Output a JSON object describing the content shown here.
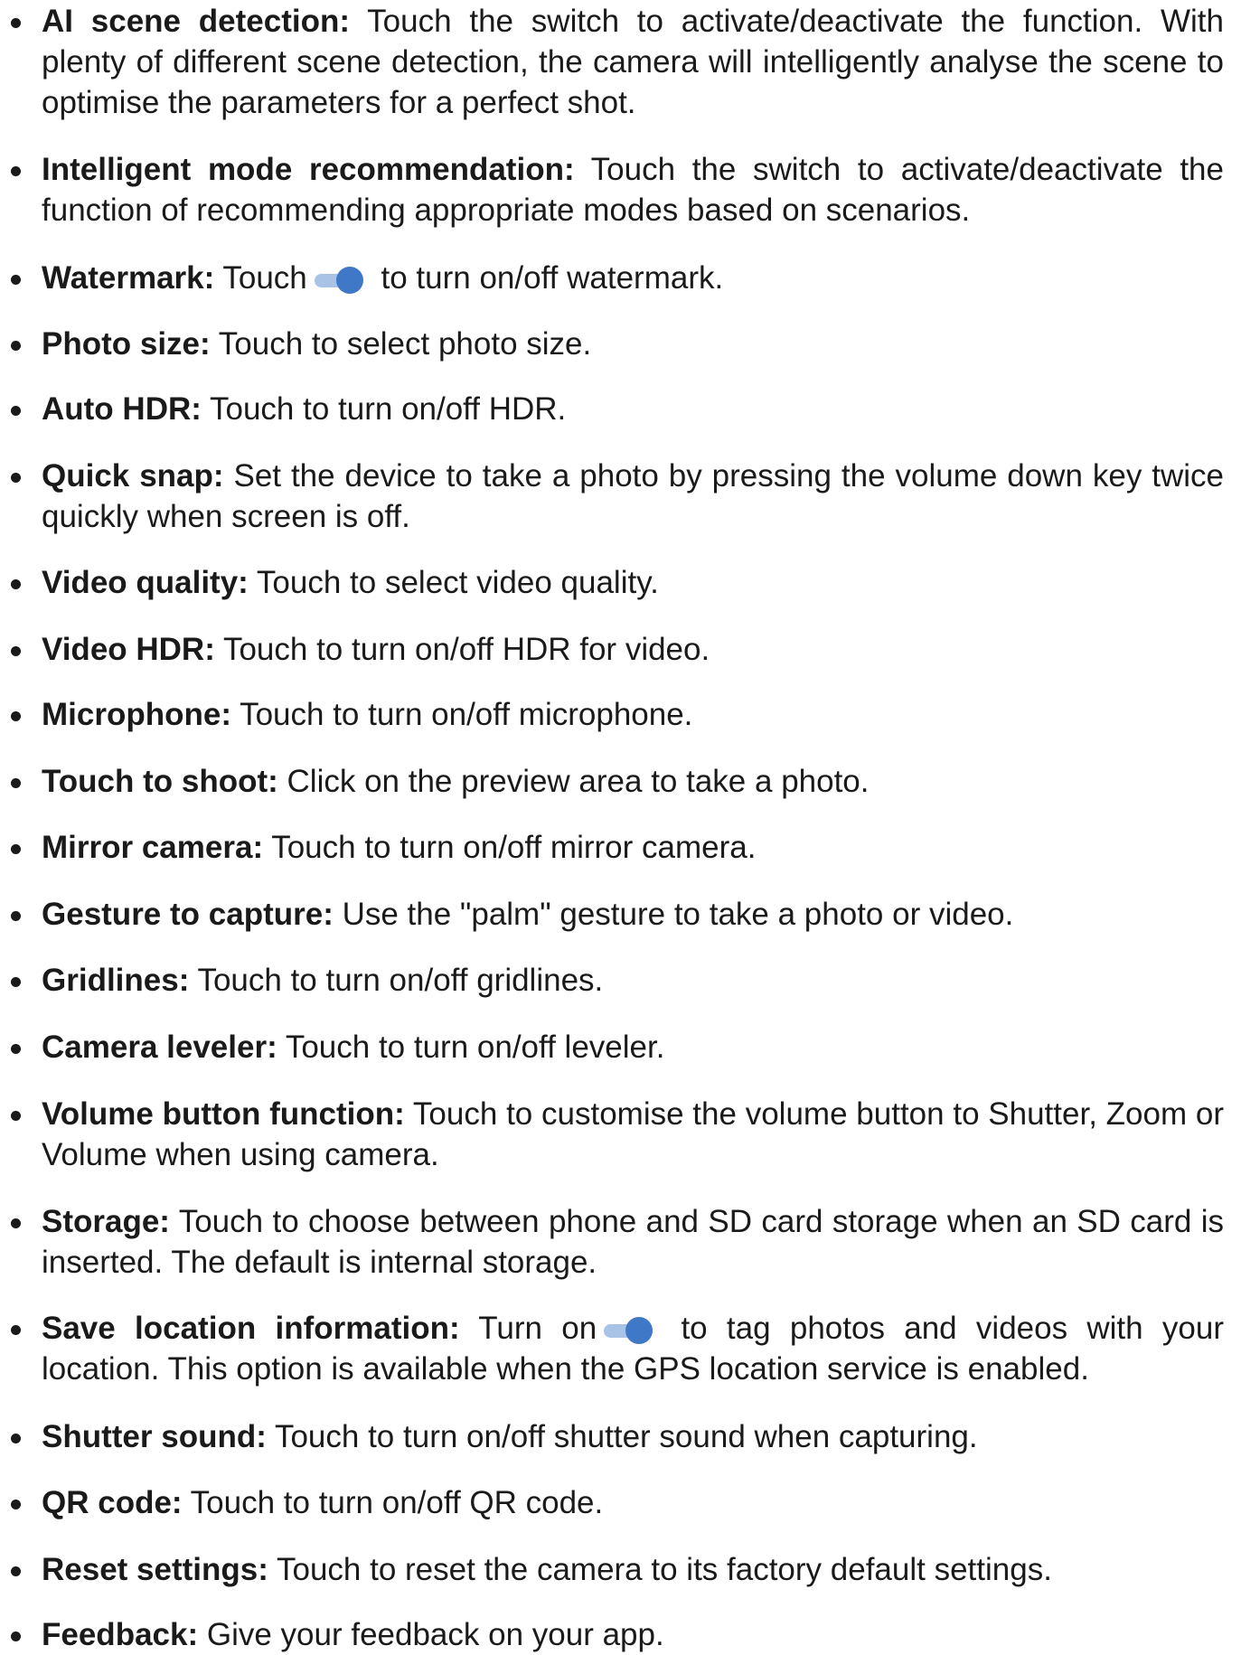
{
  "settings": [
    {
      "term": "AI scene detection:",
      "text": " Touch the switch to activate/deactivate the function. With plenty of different scene detection, the camera will intelligently analyse the scene to optimise the parameters for a perfect shot."
    },
    {
      "term": "Intelligent mode recommendation:",
      "text": " Touch the switch to activate/deactivate the function of recommending appropriate modes based on scenarios."
    },
    {
      "term": "Watermark:",
      "text_before": " Touch",
      "text_after": " to turn on/off watermark.",
      "icon": "toggle-on-icon"
    },
    {
      "term": "Photo size:",
      "text": " Touch to select photo size."
    },
    {
      "term": "Auto HDR:",
      "text": " Touch to turn on/off HDR."
    },
    {
      "term": "Quick snap:",
      "text": " Set the device to take a photo by pressing the volume down key twice quickly when screen is off."
    },
    {
      "term": "Video quality:",
      "text": " Touch to select video quality."
    },
    {
      "term": "Video HDR:",
      "text": " Touch to turn on/off HDR for video."
    },
    {
      "term": "Microphone:",
      "text": " Touch to turn on/off microphone."
    },
    {
      "term": "Touch to shoot:",
      "text": " Click on the preview area to take a photo."
    },
    {
      "term": "Mirror camera:",
      "text": " Touch to turn on/off mirror camera."
    },
    {
      "term": "Gesture to capture:",
      "text": " Use the \"palm\" gesture to take a photo or video."
    },
    {
      "term": "Gridlines:",
      "text": " Touch to turn on/off gridlines."
    },
    {
      "term": "Camera leveler:",
      "text": " Touch to turn on/off leveler."
    },
    {
      "term": "Volume button function:",
      "text": " Touch to customise the volume button to Shutter, Zoom or Volume when using camera."
    },
    {
      "term": "Storage:",
      "text": " Touch to choose between phone and SD card storage when an SD card is inserted. The default is internal storage."
    },
    {
      "term": "Save location information:",
      "text_before": " Turn on",
      "text_after": " to tag photos and videos with your location. This option is available when the GPS location service is enabled.",
      "icon": "toggle-on-icon"
    },
    {
      "term": "Shutter sound:",
      "text": " Touch to turn on/off shutter sound when capturing."
    },
    {
      "term": "QR code:",
      "text": " Touch to turn on/off QR code."
    },
    {
      "term": "Reset settings:",
      "text": " Touch to reset the camera to its factory default settings."
    },
    {
      "term": "Feedback:",
      "text": " Give your feedback on your app."
    }
  ],
  "colors": {
    "text": "#1a1a1a",
    "toggle_track": "#a8c3e6",
    "toggle_knob": "#3f78c6"
  }
}
